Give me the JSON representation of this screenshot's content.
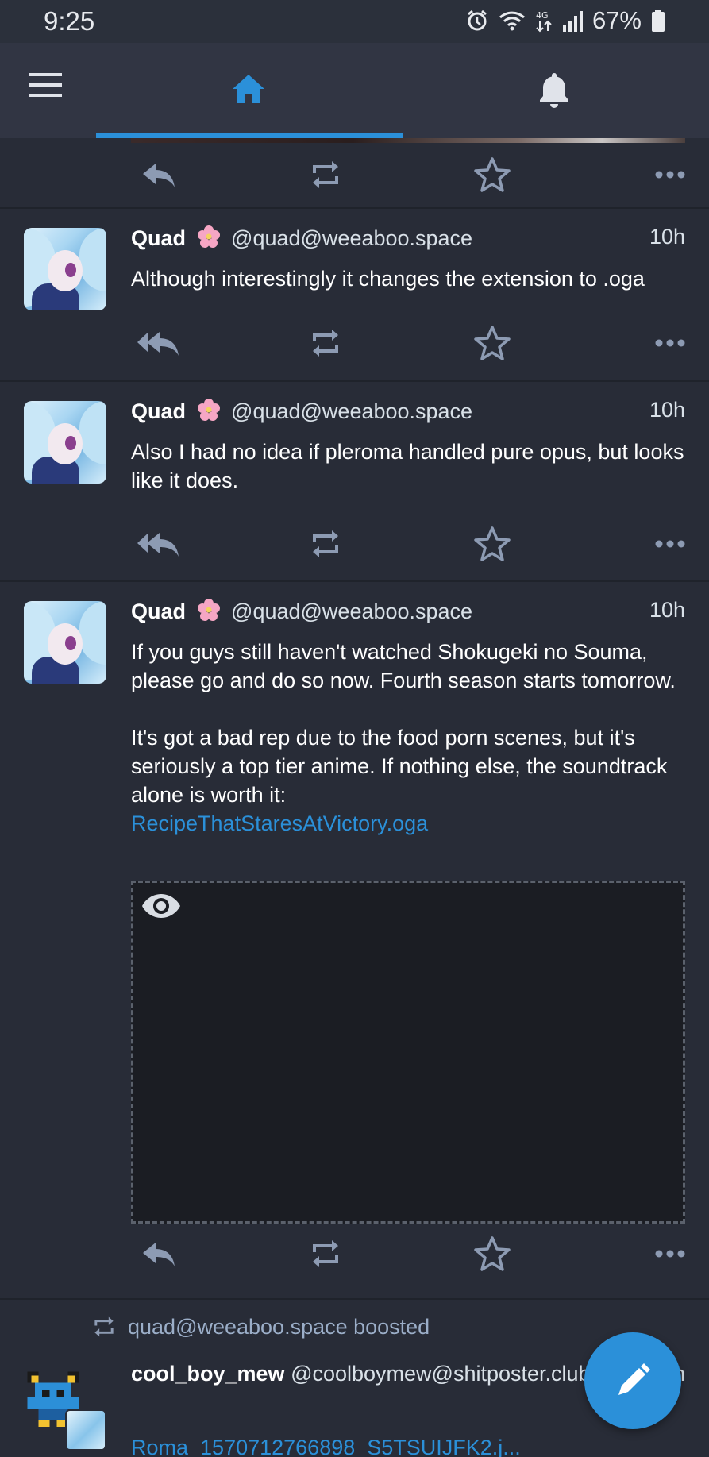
{
  "status_bar": {
    "time": "9:25",
    "battery": "67%"
  },
  "nav": {
    "active_tab": "home",
    "accent_color": "#2b90d9"
  },
  "statuses": [
    {
      "display_name": "Quad",
      "emoji": "cherry-blossom",
      "acct": "@quad@weeaboo.space",
      "time": "10h",
      "content": [
        "Although interestingly it changes the extension to .oga"
      ]
    },
    {
      "display_name": "Quad",
      "emoji": "cherry-blossom",
      "acct": "@quad@weeaboo.space",
      "time": "10h",
      "content": [
        "Also I had no idea if pleroma handled pure opus, but looks like it does."
      ]
    },
    {
      "display_name": "Quad",
      "emoji": "cherry-blossom",
      "acct": "@quad@weeaboo.space",
      "time": "10h",
      "content": [
        "If you guys still haven't watched Shokugeki no Souma, please go and do so now. Fourth season starts tomorrow.",
        "It's got a bad rep due to the food porn scenes, but it's seriously a top tier anime. If nothing else, the soundtrack alone is worth it:"
      ],
      "link": "RecipeThatStaresAtVictory.oga"
    }
  ],
  "boosted": {
    "boost_text": "quad@weeaboo.space boosted",
    "display_name": "cool_boy_mew",
    "acct": "@coolboymew@shitposter.club",
    "time_partial": "h",
    "link_partial": "Roma_1570712766898_S5TSUIJFK2.j..."
  }
}
